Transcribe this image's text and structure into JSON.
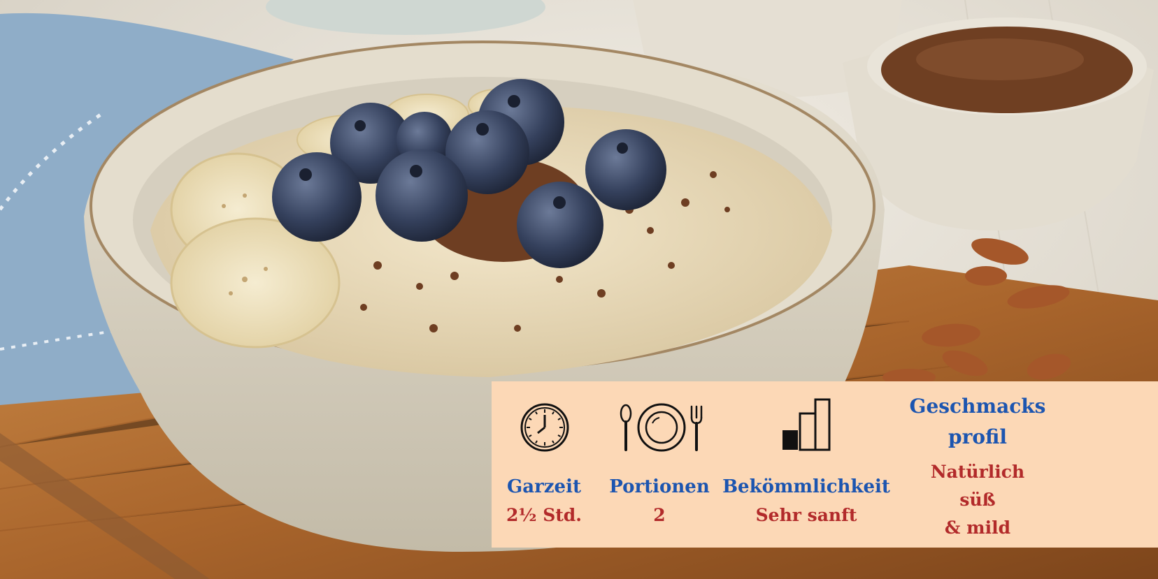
{
  "photo": {
    "subject": "porridge-bowl",
    "colors": {
      "bowl": "#d9d2c2",
      "porridge": "#e9dcbf",
      "blueberry": "#2f3b55",
      "banana": "#efe3c0",
      "flax": "#6e3e22",
      "board": "#b06a30",
      "napkin": "#8eadc9"
    }
  },
  "panel": {
    "background": "#fcd8b6",
    "label_color": "#1c55b0",
    "value_color": "#b22a2a",
    "items": [
      {
        "icon": "clock-icon",
        "label": "Garzeit",
        "value": "2½ Std."
      },
      {
        "icon": "plate-cutlery-icon",
        "label": "Portionen",
        "value": "2"
      },
      {
        "icon": "bar-level-icon",
        "label": "Bekömmlichkeit",
        "value": "Sehr sanft"
      }
    ],
    "profile": {
      "title_line1": "Geschmacks",
      "title_line2": "profil",
      "value_line1": "Natürlich",
      "value_line2": "süß",
      "value_line3": "& mild"
    }
  }
}
